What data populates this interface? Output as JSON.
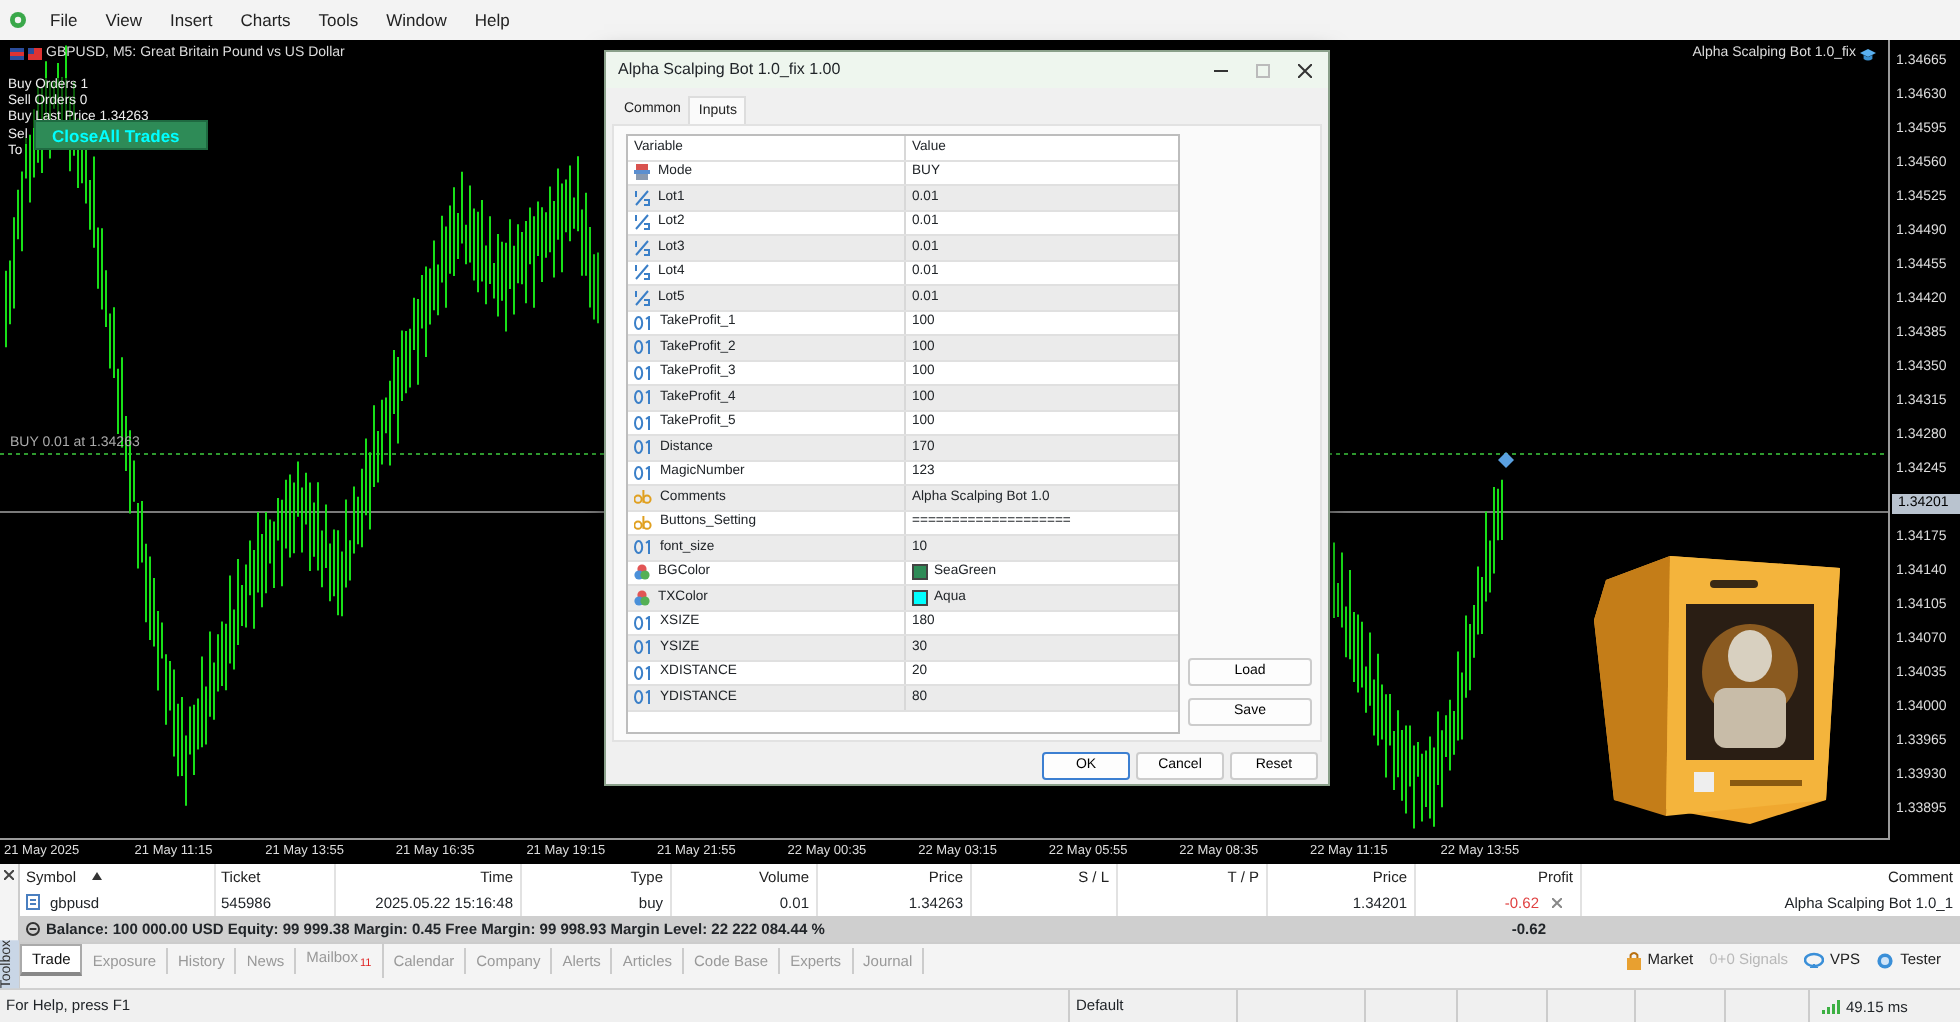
{
  "menu_bar": {
    "items": [
      "File",
      "View",
      "Insert",
      "Charts",
      "Tools",
      "Window",
      "Help"
    ]
  },
  "chart": {
    "title": "GBPUSD, M5:  Great Britain Pound vs US Dollar",
    "expert_name": "Alpha Scalping Bot 1.0_fix",
    "info_lines": [
      "Buy Orders 1",
      "Sell Orders 0",
      "Buy Last Price 1.34263",
      "Sel",
      "To"
    ],
    "close_button": "CloseAll Trades",
    "order_label": "BUY 0.01 at 1.34263",
    "price_axis": [
      {
        "label": "1.34665",
        "kind": "tick"
      },
      {
        "label": "1.34630",
        "kind": "tick"
      },
      {
        "label": "1.34595",
        "kind": "tick"
      },
      {
        "label": "1.34560",
        "kind": "tick"
      },
      {
        "label": "1.34525",
        "kind": "tick"
      },
      {
        "label": "1.34490",
        "kind": "tick"
      },
      {
        "label": "1.34455",
        "kind": "tick"
      },
      {
        "label": "1.34420",
        "kind": "tick"
      },
      {
        "label": "1.34385",
        "kind": "tick"
      },
      {
        "label": "1.34350",
        "kind": "tick"
      },
      {
        "label": "1.34315",
        "kind": "tick"
      },
      {
        "label": "1.34280",
        "kind": "tick"
      },
      {
        "label": "1.34245",
        "kind": "tick"
      },
      {
        "label": "1.34201",
        "kind": "current"
      },
      {
        "label": "1.34175",
        "kind": "tick"
      },
      {
        "label": "1.34140",
        "kind": "tick"
      },
      {
        "label": "1.34105",
        "kind": "tick"
      },
      {
        "label": "1.34070",
        "kind": "tick"
      },
      {
        "label": "1.34035",
        "kind": "tick"
      },
      {
        "label": "1.34000",
        "kind": "tick"
      },
      {
        "label": "1.33965",
        "kind": "tick"
      },
      {
        "label": "1.33930",
        "kind": "tick"
      },
      {
        "label": "1.33895",
        "kind": "tick"
      }
    ],
    "time_axis": [
      "21 May 2025",
      "21 May 11:15",
      "21 May 13:55",
      "21 May 16:35",
      "21 May 19:15",
      "21 May 21:55",
      "22 May 00:35",
      "22 May 03:15",
      "22 May 05:55",
      "22 May 08:35",
      "22 May 11:15",
      "22 May 13:55"
    ]
  },
  "dialog": {
    "title": "Alpha Scalping Bot 1.0_fix 1.00",
    "tabs": [
      {
        "label": "Common",
        "selected": false
      },
      {
        "label": "Inputs",
        "selected": true
      }
    ],
    "columns": [
      "Variable",
      "Value"
    ],
    "inputs": [
      {
        "kind": "enum",
        "name": "Mode",
        "value": "BUY"
      },
      {
        "kind": "double",
        "name": "Lot1",
        "value": "0.01"
      },
      {
        "kind": "double",
        "name": "Lot2",
        "value": "0.01"
      },
      {
        "kind": "double",
        "name": "Lot3",
        "value": "0.01"
      },
      {
        "kind": "double",
        "name": "Lot4",
        "value": "0.01"
      },
      {
        "kind": "double",
        "name": "Lot5",
        "value": "0.01"
      },
      {
        "kind": "int",
        "name": "TakeProfit_1",
        "value": "100"
      },
      {
        "kind": "int",
        "name": "TakeProfit_2",
        "value": "100"
      },
      {
        "kind": "int",
        "name": "TakeProfit_3",
        "value": "100"
      },
      {
        "kind": "int",
        "name": "TakeProfit_4",
        "value": "100"
      },
      {
        "kind": "int",
        "name": "TakeProfit_5",
        "value": "100"
      },
      {
        "kind": "int",
        "name": "Distance",
        "value": "170"
      },
      {
        "kind": "int",
        "name": "MagicNumber",
        "value": "123"
      },
      {
        "kind": "string",
        "name": "Comments",
        "value": "Alpha Scalping Bot 1.0"
      },
      {
        "kind": "string",
        "name": "Buttons_Setting",
        "value": "===================="
      },
      {
        "kind": "int",
        "name": "font_size",
        "value": "10"
      },
      {
        "kind": "color",
        "name": "BGColor",
        "value": "SeaGreen",
        "color": "#2e8b57"
      },
      {
        "kind": "color",
        "name": "TXColor",
        "value": "Aqua",
        "color": "#00ffff"
      },
      {
        "kind": "int",
        "name": "XSIZE",
        "value": "180"
      },
      {
        "kind": "int",
        "name": "YSIZE",
        "value": "30"
      },
      {
        "kind": "int",
        "name": "XDISTANCE",
        "value": "20"
      },
      {
        "kind": "int",
        "name": "YDISTANCE",
        "value": "80"
      }
    ],
    "side_buttons": [
      "Load",
      "Save"
    ],
    "buttons": [
      {
        "label": "OK",
        "default": true
      },
      {
        "label": "Cancel",
        "default": false
      },
      {
        "label": "Reset",
        "default": false
      }
    ]
  },
  "terminal": {
    "toolbox_label": "Toolbox",
    "columns": [
      {
        "label": "Symbol",
        "sorted": true
      },
      {
        "label": "Ticket",
        "sorted": false
      },
      {
        "label": "Time",
        "sorted": false
      },
      {
        "label": "Type",
        "sorted": false
      },
      {
        "label": "Volume",
        "sorted": false
      },
      {
        "label": "Price",
        "sorted": false
      },
      {
        "label": "S / L",
        "sorted": false
      },
      {
        "label": "T / P",
        "sorted": false
      },
      {
        "label": "Price",
        "sorted": false
      },
      {
        "label": "Profit",
        "sorted": false
      },
      {
        "label": "Comment",
        "sorted": false
      }
    ],
    "rows": [
      {
        "symbol": "gbpusd",
        "ticket": "545986",
        "time": "2025.05.22 15:16:48",
        "type": "buy",
        "volume": "0.01",
        "price": "1.34263",
        "current_price": "1.34201",
        "profit": "-0.62",
        "loss": true,
        "comment": "Alpha Scalping Bot 1.0_1"
      }
    ],
    "summary": {
      "text": "Balance: 100 000.00 USD  Equity: 99 999.38  Margin: 0.45  Free Margin: 99 998.93  Margin Level: 22 222 084.44 %",
      "profit": "-0.62"
    },
    "tabs": [
      {
        "label": "Trade",
        "selected": true
      },
      {
        "label": "Exposure",
        "selected": false
      },
      {
        "label": "History",
        "selected": false
      },
      {
        "label": "News",
        "selected": false
      },
      {
        "label": "Mailbox",
        "selected": false,
        "badge": "11"
      },
      {
        "label": "Calendar",
        "selected": false
      },
      {
        "label": "Company",
        "selected": false
      },
      {
        "label": "Alerts",
        "selected": false
      },
      {
        "label": "Articles",
        "selected": false
      },
      {
        "label": "Code Base",
        "selected": false
      },
      {
        "label": "Experts",
        "selected": false
      },
      {
        "label": "Journal",
        "selected": false
      }
    ],
    "links": [
      {
        "kind": "market",
        "label": "Market",
        "disabled": false
      },
      {
        "kind": "signals",
        "label": "0+0 Signals",
        "disabled": true
      },
      {
        "kind": "vps",
        "label": "VPS",
        "disabled": false
      },
      {
        "kind": "tester",
        "label": "Tester",
        "disabled": false
      }
    ]
  },
  "status_bar": {
    "help": "For Help, press F1",
    "profile": "Default",
    "ping": "49.15 ms"
  }
}
